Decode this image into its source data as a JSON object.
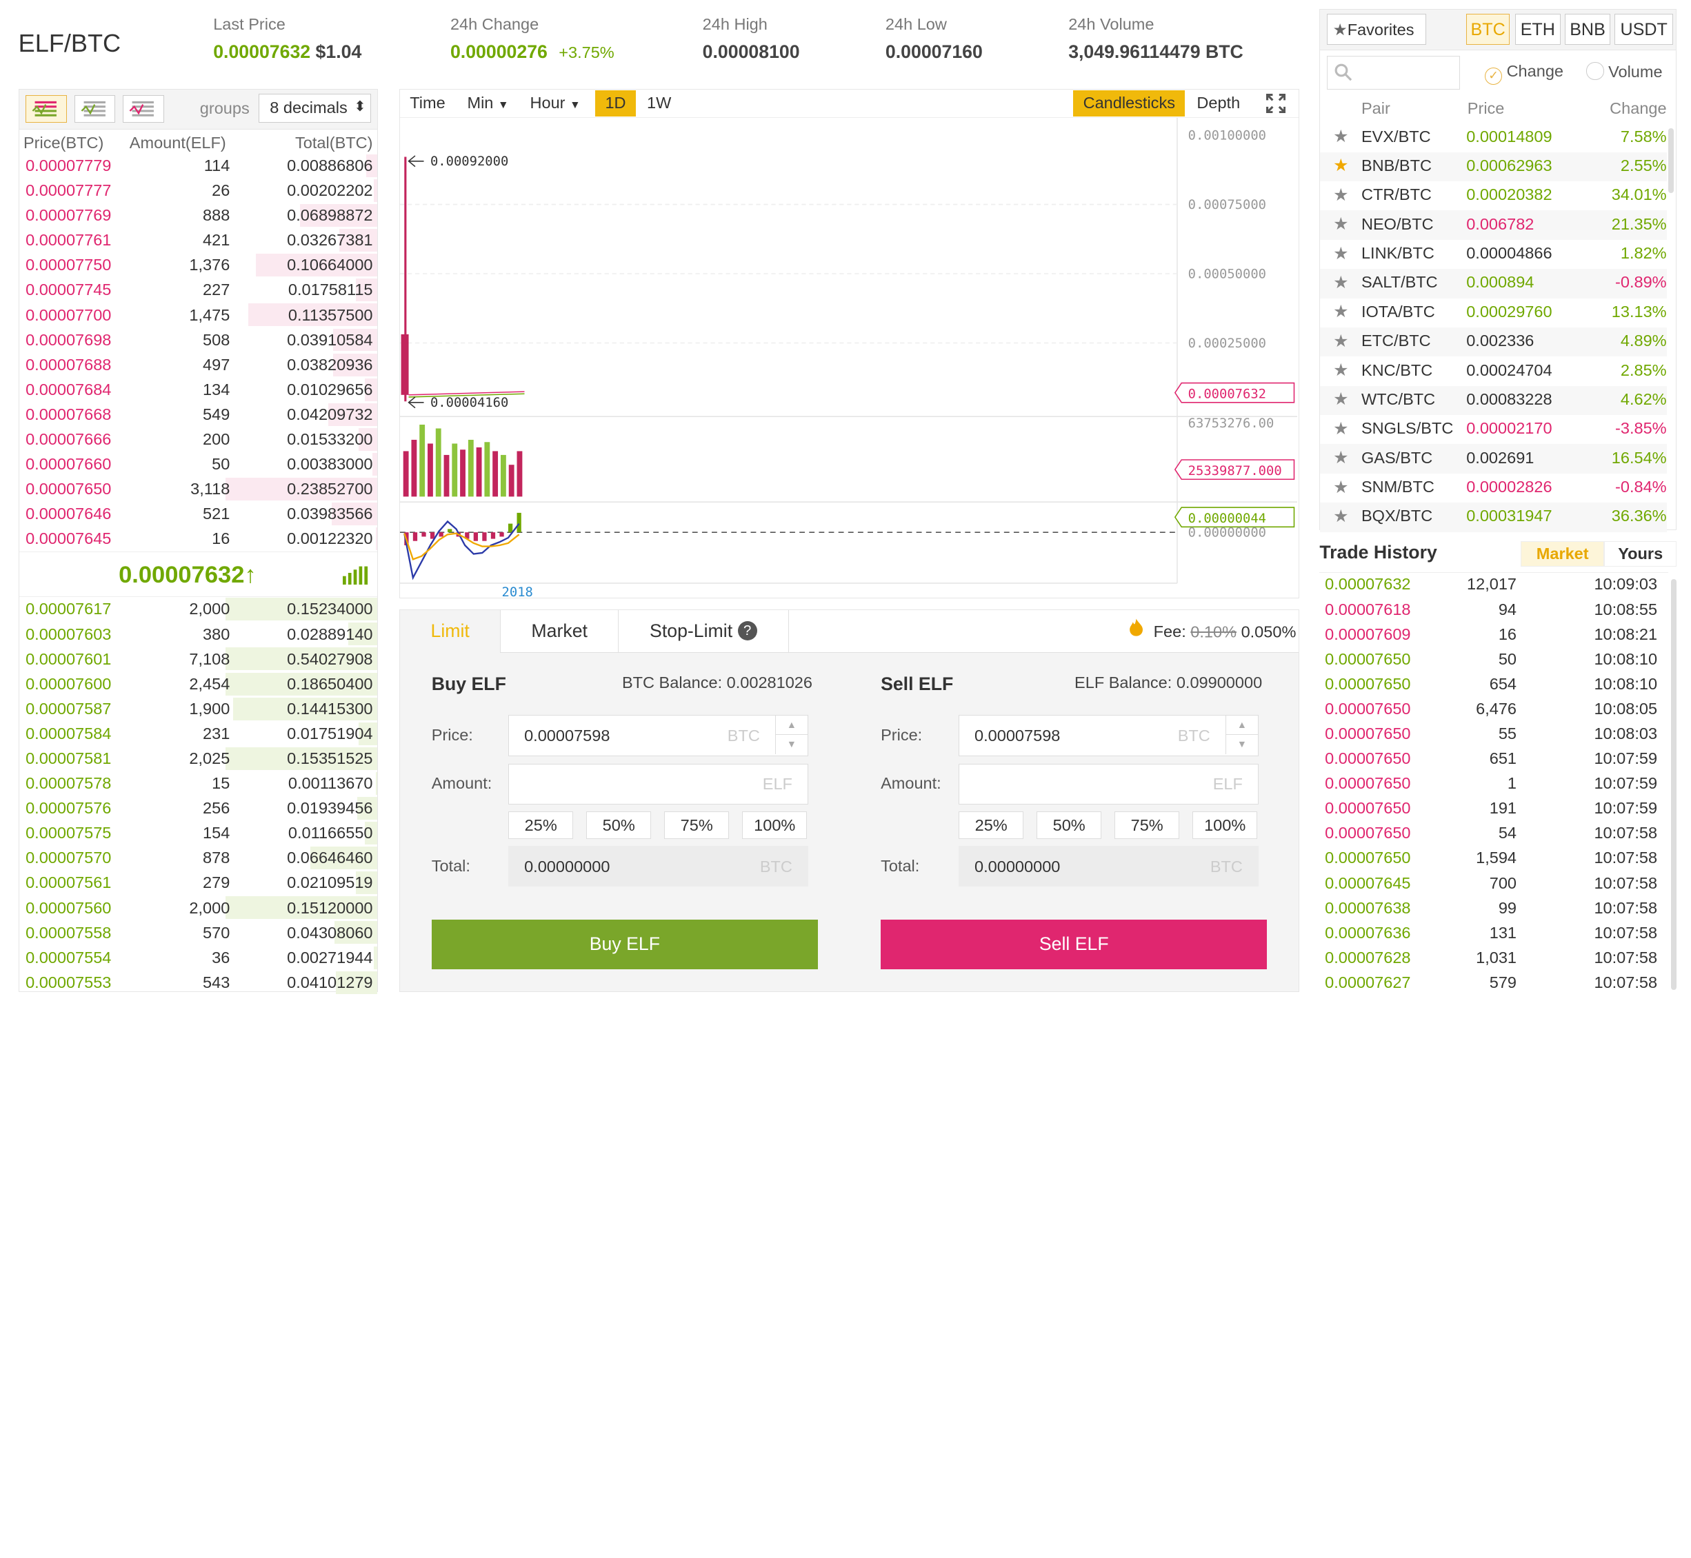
{
  "header": {
    "pair": "ELF/BTC",
    "last_price_label": "Last Price",
    "last_price": "0.00007632",
    "last_price_usd": "$1.04",
    "change_label": "24h Change",
    "change_value": "0.00000276",
    "change_pct": "+3.75%",
    "high_label": "24h High",
    "high_value": "0.00008100",
    "low_label": "24h Low",
    "low_value": "0.00007160",
    "volume_label": "24h Volume",
    "volume_value": "3,049.96114479 BTC"
  },
  "orderbook": {
    "groups_label": "groups",
    "groups_value": "8 decimals",
    "col_price": "Price(BTC)",
    "col_amount": "Amount(ELF)",
    "col_total": "Total(BTC)",
    "asks": [
      {
        "price": "0.00007779",
        "amount": "114",
        "total": "0.00886806",
        "depth": 0.07
      },
      {
        "price": "0.00007777",
        "amount": "26",
        "total": "0.00202202",
        "depth": 0.02
      },
      {
        "price": "0.00007769",
        "amount": "888",
        "total": "0.06898872",
        "depth": 0.51
      },
      {
        "price": "0.00007761",
        "amount": "421",
        "total": "0.03267381",
        "depth": 0.25
      },
      {
        "price": "0.00007750",
        "amount": "1,376",
        "total": "0.10664000",
        "depth": 0.8
      },
      {
        "price": "0.00007745",
        "amount": "227",
        "total": "0.01758115",
        "depth": 0.14
      },
      {
        "price": "0.00007700",
        "amount": "1,475",
        "total": "0.11357500",
        "depth": 0.85
      },
      {
        "price": "0.00007698",
        "amount": "508",
        "total": "0.03910584",
        "depth": 0.29
      },
      {
        "price": "0.00007688",
        "amount": "497",
        "total": "0.03820936",
        "depth": 0.29
      },
      {
        "price": "0.00007684",
        "amount": "134",
        "total": "0.01029656",
        "depth": 0.08
      },
      {
        "price": "0.00007668",
        "amount": "549",
        "total": "0.04209732",
        "depth": 0.32
      },
      {
        "price": "0.00007666",
        "amount": "200",
        "total": "0.01533200",
        "depth": 0.12
      },
      {
        "price": "0.00007660",
        "amount": "50",
        "total": "0.00383000",
        "depth": 0.03
      },
      {
        "price": "0.00007650",
        "amount": "3,118",
        "total": "0.23852700",
        "depth": 1.0
      },
      {
        "price": "0.00007646",
        "amount": "521",
        "total": "0.03983566",
        "depth": 0.3
      },
      {
        "price": "0.00007645",
        "amount": "16",
        "total": "0.00122320",
        "depth": 0.01
      }
    ],
    "last": "0.00007632",
    "last_arrow": "↑",
    "bids": [
      {
        "price": "0.00007617",
        "amount": "2,000",
        "total": "0.15234000",
        "depth": 1.0
      },
      {
        "price": "0.00007603",
        "amount": "380",
        "total": "0.02889140",
        "depth": 0.19
      },
      {
        "price": "0.00007601",
        "amount": "7,108",
        "total": "0.54027908",
        "depth": 1.0
      },
      {
        "price": "0.00007600",
        "amount": "2,454",
        "total": "0.18650400",
        "depth": 1.0
      },
      {
        "price": "0.00007587",
        "amount": "1,900",
        "total": "0.14415300",
        "depth": 0.95
      },
      {
        "price": "0.00007584",
        "amount": "231",
        "total": "0.01751904",
        "depth": 0.12
      },
      {
        "price": "0.00007581",
        "amount": "2,025",
        "total": "0.15351525",
        "depth": 1.0
      },
      {
        "price": "0.00007578",
        "amount": "15",
        "total": "0.00113670",
        "depth": 0.01
      },
      {
        "price": "0.00007576",
        "amount": "256",
        "total": "0.01939456",
        "depth": 0.13
      },
      {
        "price": "0.00007575",
        "amount": "154",
        "total": "0.01166550",
        "depth": 0.08
      },
      {
        "price": "0.00007570",
        "amount": "878",
        "total": "0.06646460",
        "depth": 0.44
      },
      {
        "price": "0.00007561",
        "amount": "279",
        "total": "0.02109519",
        "depth": 0.14
      },
      {
        "price": "0.00007560",
        "amount": "2,000",
        "total": "0.15120000",
        "depth": 1.0
      },
      {
        "price": "0.00007558",
        "amount": "570",
        "total": "0.04308060",
        "depth": 0.28
      },
      {
        "price": "0.00007554",
        "amount": "36",
        "total": "0.00271944",
        "depth": 0.02
      },
      {
        "price": "0.00007553",
        "amount": "543",
        "total": "0.04101279",
        "depth": 0.27
      }
    ]
  },
  "chart": {
    "buttons": [
      "Time",
      "Min",
      "Hour",
      "1D",
      "1W"
    ],
    "active_button": "1D",
    "view_candles": "Candlesticks",
    "view_depth": "Depth",
    "y_labels": [
      "0.00100000",
      "0.00075000",
      "0.00050000",
      "0.00025000"
    ],
    "hi_label": "0.00092000",
    "lo_label": "0.00004160",
    "price_tag": "0.00007632",
    "vol_label": "63753276.00",
    "vol_tag": "25339877.000",
    "macd_tag": "0.00000044",
    "macd_zero": "0.00000000",
    "x_label": "2018",
    "volumes": [
      0.6,
      0.75,
      0.95,
      0.7,
      0.9,
      0.55,
      0.7,
      0.62,
      0.75,
      0.65,
      0.72,
      0.6,
      0.55,
      0.42,
      0.6
    ],
    "vol_colors": [
      "r",
      "r",
      "g",
      "r",
      "g",
      "r",
      "g",
      "r",
      "g",
      "r",
      "g",
      "r",
      "g",
      "r",
      "r"
    ]
  },
  "form": {
    "tabs": [
      "Limit",
      "Market",
      "Stop-Limit"
    ],
    "help_glyph": "?",
    "fee_label": "Fee:",
    "fee_old": "0.10%",
    "fee_new": "0.050%",
    "buy": {
      "title": "Buy ELF",
      "balance": "BTC Balance: 0.00281026",
      "price_label": "Price:",
      "price_value": "0.00007598",
      "price_unit": "BTC",
      "amount_label": "Amount:",
      "amount_unit": "ELF",
      "total_label": "Total:",
      "total_value": "0.00000000",
      "total_unit": "BTC",
      "button": "Buy ELF"
    },
    "sell": {
      "title": "Sell ELF",
      "balance": "ELF Balance: 0.09900000",
      "price_label": "Price:",
      "price_value": "0.00007598",
      "price_unit": "BTC",
      "amount_label": "Amount:",
      "amount_unit": "ELF",
      "total_label": "Total:",
      "total_value": "0.00000000",
      "total_unit": "BTC",
      "button": "Sell ELF"
    },
    "percents": [
      "25%",
      "50%",
      "75%",
      "100%"
    ]
  },
  "markets": {
    "favorites": "Favorites",
    "tabs": [
      "BTC",
      "ETH",
      "BNB",
      "USDT"
    ],
    "active_tab": "BTC",
    "radio_change": "Change",
    "radio_volume": "Volume",
    "col_pair": "Pair",
    "col_price": "Price",
    "col_change": "Change",
    "rows": [
      {
        "pair": "EVX/BTC",
        "price": "0.00014809",
        "change": "7.58%",
        "pc": "g",
        "cc": "g",
        "fav": false
      },
      {
        "pair": "BNB/BTC",
        "price": "0.00062963",
        "change": "2.55%",
        "pc": "g",
        "cc": "g",
        "fav": true
      },
      {
        "pair": "CTR/BTC",
        "price": "0.00020382",
        "change": "34.01%",
        "pc": "g",
        "cc": "g",
        "fav": false
      },
      {
        "pair": "NEO/BTC",
        "price": "0.006782",
        "change": "21.35%",
        "pc": "r",
        "cc": "g",
        "fav": false
      },
      {
        "pair": "LINK/BTC",
        "price": "0.00004866",
        "change": "1.82%",
        "pc": "k",
        "cc": "g",
        "fav": false
      },
      {
        "pair": "SALT/BTC",
        "price": "0.000894",
        "change": "-0.89%",
        "pc": "g",
        "cc": "r",
        "fav": false
      },
      {
        "pair": "IOTA/BTC",
        "price": "0.00029760",
        "change": "13.13%",
        "pc": "g",
        "cc": "g",
        "fav": false
      },
      {
        "pair": "ETC/BTC",
        "price": "0.002336",
        "change": "4.89%",
        "pc": "k",
        "cc": "g",
        "fav": false
      },
      {
        "pair": "KNC/BTC",
        "price": "0.00024704",
        "change": "2.85%",
        "pc": "k",
        "cc": "g",
        "fav": false
      },
      {
        "pair": "WTC/BTC",
        "price": "0.00083228",
        "change": "4.62%",
        "pc": "k",
        "cc": "g",
        "fav": false
      },
      {
        "pair": "SNGLS/BTC",
        "price": "0.00002170",
        "change": "-3.85%",
        "pc": "r",
        "cc": "r",
        "fav": false
      },
      {
        "pair": "GAS/BTC",
        "price": "0.002691",
        "change": "16.54%",
        "pc": "k",
        "cc": "g",
        "fav": false
      },
      {
        "pair": "SNM/BTC",
        "price": "0.00002826",
        "change": "-0.84%",
        "pc": "r",
        "cc": "r",
        "fav": false
      },
      {
        "pair": "BQX/BTC",
        "price": "0.00031947",
        "change": "36.36%",
        "pc": "g",
        "cc": "g",
        "fav": false
      }
    ]
  },
  "trades": {
    "title": "Trade History",
    "tab_market": "Market",
    "tab_yours": "Yours",
    "rows": [
      {
        "price": "0.00007632",
        "amount": "12,017",
        "time": "10:09:03",
        "c": "g"
      },
      {
        "price": "0.00007618",
        "amount": "94",
        "time": "10:08:55",
        "c": "r"
      },
      {
        "price": "0.00007609",
        "amount": "16",
        "time": "10:08:21",
        "c": "r"
      },
      {
        "price": "0.00007650",
        "amount": "50",
        "time": "10:08:10",
        "c": "g"
      },
      {
        "price": "0.00007650",
        "amount": "654",
        "time": "10:08:10",
        "c": "g"
      },
      {
        "price": "0.00007650",
        "amount": "6,476",
        "time": "10:08:05",
        "c": "r"
      },
      {
        "price": "0.00007650",
        "amount": "55",
        "time": "10:08:03",
        "c": "r"
      },
      {
        "price": "0.00007650",
        "amount": "651",
        "time": "10:07:59",
        "c": "r"
      },
      {
        "price": "0.00007650",
        "amount": "1",
        "time": "10:07:59",
        "c": "r"
      },
      {
        "price": "0.00007650",
        "amount": "191",
        "time": "10:07:59",
        "c": "r"
      },
      {
        "price": "0.00007650",
        "amount": "54",
        "time": "10:07:58",
        "c": "r"
      },
      {
        "price": "0.00007650",
        "amount": "1,594",
        "time": "10:07:58",
        "c": "g"
      },
      {
        "price": "0.00007645",
        "amount": "700",
        "time": "10:07:58",
        "c": "g"
      },
      {
        "price": "0.00007638",
        "amount": "99",
        "time": "10:07:58",
        "c": "g"
      },
      {
        "price": "0.00007636",
        "amount": "131",
        "time": "10:07:58",
        "c": "g"
      },
      {
        "price": "0.00007628",
        "amount": "1,031",
        "time": "10:07:58",
        "c": "g"
      },
      {
        "price": "0.00007627",
        "amount": "579",
        "time": "10:07:58",
        "c": "g"
      }
    ]
  },
  "colors": {
    "green": "#70a800",
    "red": "#e0266f",
    "accent": "#f0b90b",
    "buy": "#7aa62a",
    "sell": "#e0266f"
  }
}
